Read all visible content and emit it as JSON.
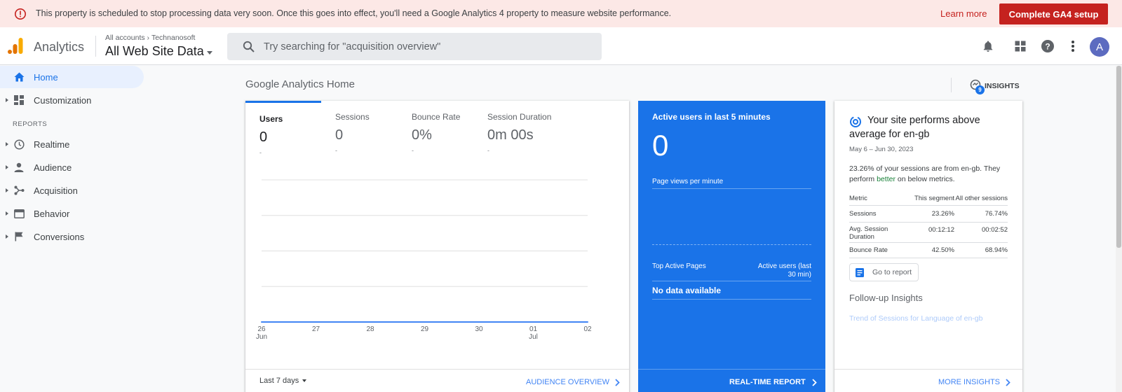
{
  "banner": {
    "message": "This property is scheduled to stop processing data very soon. Once this goes into effect, you'll need a Google Analytics 4 property to measure website performance.",
    "learn_more": "Learn more",
    "cta": "Complete GA4 setup"
  },
  "header": {
    "app_name": "Analytics",
    "breadcrumb": [
      "All accounts",
      "Technanosoft"
    ],
    "view_name": "All Web Site Data",
    "search_placeholder": "Try searching for \"acquisition overview\"",
    "avatar_initial": "A"
  },
  "sidebar": {
    "top_items": [
      {
        "label": "Home",
        "icon": "home-icon",
        "active": true
      },
      {
        "label": "Customization",
        "icon": "dashboard-icon",
        "active": false
      }
    ],
    "reports_header": "REPORTS",
    "report_items": [
      {
        "label": "Realtime",
        "icon": "clock-icon"
      },
      {
        "label": "Audience",
        "icon": "person-icon"
      },
      {
        "label": "Acquisition",
        "icon": "acquisition-icon"
      },
      {
        "label": "Behavior",
        "icon": "behavior-icon"
      },
      {
        "label": "Conversions",
        "icon": "flag-icon"
      }
    ]
  },
  "main": {
    "title": "Google Analytics Home",
    "insights_label": "INSIGHTS",
    "insights_count": "9"
  },
  "overview": {
    "metrics": [
      {
        "name": "Users",
        "value": "0",
        "change": "-"
      },
      {
        "name": "Sessions",
        "value": "0",
        "change": "-"
      },
      {
        "name": "Bounce Rate",
        "value": "0%",
        "change": "-"
      },
      {
        "name": "Session Duration",
        "value": "0m 00s",
        "change": "-"
      }
    ],
    "date_range": "Last 7 days",
    "footer_link": "AUDIENCE OVERVIEW"
  },
  "chart_data": {
    "type": "line",
    "x": [
      "26 Jun",
      "27",
      "28",
      "29",
      "30",
      "01 Jul",
      "02"
    ],
    "tick_labels": [
      {
        "day": "26",
        "month": "Jun"
      },
      {
        "day": "27",
        "month": ""
      },
      {
        "day": "28",
        "month": ""
      },
      {
        "day": "29",
        "month": ""
      },
      {
        "day": "30",
        "month": ""
      },
      {
        "day": "01",
        "month": "Jul"
      },
      {
        "day": "02",
        "month": ""
      }
    ],
    "series": [
      {
        "values": [
          0,
          0,
          0,
          0,
          0,
          0,
          0
        ]
      }
    ],
    "grid": true,
    "line_color": "#4285f4"
  },
  "realtime": {
    "title": "Active users in last 5 minutes",
    "value": "0",
    "pageviews_label": "Page views per minute",
    "top_pages_label": "Top Active Pages",
    "active_users_label": "Active users (last 30 min)",
    "no_data": "No data available",
    "footer_link": "REAL-TIME REPORT"
  },
  "insight": {
    "title": "Your site performs above average for en-gb",
    "date": "May 6 – Jun 30, 2023",
    "body_prefix": "23.26% of your sessions are from en-gb. They perform ",
    "body_highlight": "better",
    "body_suffix": " on below metrics.",
    "table_headers": [
      "Metric",
      "This segment",
      "All other sessions"
    ],
    "rows": [
      {
        "metric": "Sessions",
        "segment": "23.26%",
        "others": "76.74%"
      },
      {
        "metric": "Avg. Session Duration",
        "segment": "00:12:12",
        "others": "00:02:52"
      },
      {
        "metric": "Bounce Rate",
        "segment": "42.50%",
        "others": "68.94%"
      }
    ],
    "go_to_report": "Go to report",
    "followup_title": "Follow-up Insights",
    "followup_link": "Trend of Sessions for Language of en-gb",
    "footer_link": "MORE INSIGHTS"
  }
}
